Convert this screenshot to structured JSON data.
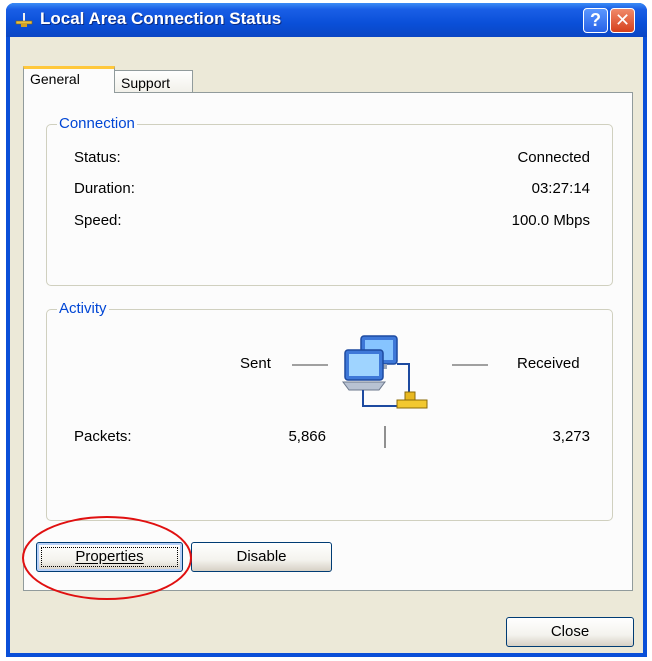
{
  "window": {
    "title": "Local Area Connection Status",
    "help_label": "?",
    "close_label": "✕"
  },
  "tabs": [
    {
      "label": "General"
    },
    {
      "label": "Support"
    }
  ],
  "connection": {
    "group_title": "Connection",
    "rows": [
      {
        "label": "Status:",
        "value": "Connected"
      },
      {
        "label": "Duration:",
        "value": "03:27:14"
      },
      {
        "label": "Speed:",
        "value": "100.0 Mbps"
      }
    ]
  },
  "activity": {
    "group_title": "Activity",
    "sent_label": "Sent",
    "received_label": "Received",
    "packets_label": "Packets:",
    "packets_sent": "5,866",
    "packets_received": "3,273"
  },
  "buttons": {
    "properties_label": "Properties",
    "disable_label": "Disable",
    "close_label": "Close"
  },
  "colors": {
    "title_bar": "#0a4fd8",
    "group_title": "#0046d5",
    "annotation_circle": "#e01010"
  }
}
